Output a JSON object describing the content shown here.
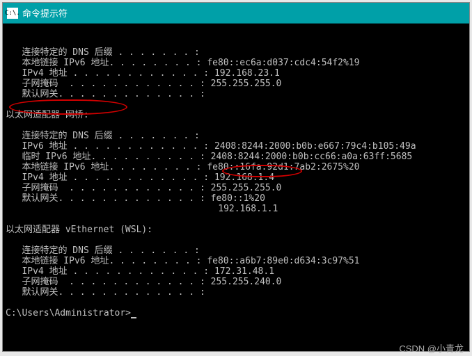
{
  "titlebar": {
    "icon_text": "C:\\.",
    "title": "命令提示符"
  },
  "adapter1": {
    "dns_suffix_label": "   连接特定的 DNS 后缀 . . . . . . . :",
    "ipv6_local_label": "   本地链接 IPv6 地址. . . . . . . . : ",
    "ipv6_local_value": "fe80::ec6a:d037:cdc4:54f2%19",
    "ipv4_label": "   IPv4 地址 . . . . . . . . . . . . : ",
    "ipv4_value": "192.168.23.1",
    "mask_label": "   子网掩码  . . . . . . . . . . . . : ",
    "mask_value": "255.255.255.0",
    "gateway_label": "   默认网关. . . . . . . . . . . . . :"
  },
  "adapter2": {
    "header": "以太网适配器 网桥:",
    "dns_suffix_label": "   连接特定的 DNS 后缀 . . . . . . . :",
    "ipv6_label": "   IPv6 地址 . . . . . . . . . . . . : ",
    "ipv6_value": "2408:8244:2000:b0b:e667:79c4:b105:49a",
    "ipv6_temp_label": "   临时 IPv6 地址. . . . . . . . . . : ",
    "ipv6_temp_value": "2408:8244:2000:b0b:cc66:a0a:63ff:5685",
    "ipv6_local_label": "   本地链接 IPv6 地址. . . . . . . . : ",
    "ipv6_local_value": "fe80::16fa:92d1:7ab2:2675%20",
    "ipv4_label": "   IPv4 地址 . . . . . . . . . . . . : ",
    "ipv4_value": "192.168.1.4",
    "mask_label": "   子网掩码  . . . . . . . . . . . . : ",
    "mask_value": "255.255.255.0",
    "gateway_label": "   默认网关. . . . . . . . . . . . . : ",
    "gateway_value1": "fe80::1%20",
    "gateway_indent": "                                       ",
    "gateway_value2": "192.168.1.1"
  },
  "adapter3": {
    "header": "以太网适配器 vEthernet (WSL):",
    "dns_suffix_label": "   连接特定的 DNS 后缀 . . . . . . . :",
    "ipv6_local_label": "   本地链接 IPv6 地址. . . . . . . . : ",
    "ipv6_local_value": "fe80::a6b7:89e0:d634:3c97%51",
    "ipv4_label": "   IPv4 地址 . . . . . . . . . . . . : ",
    "ipv4_value": "172.31.48.1",
    "mask_label": "   子网掩码  . . . . . . . . . . . . : ",
    "mask_value": "255.255.240.0",
    "gateway_label": "   默认网关. . . . . . . . . . . . . :"
  },
  "prompt": "C:\\Users\\Administrator>",
  "watermark": "CSDN @小青龙"
}
